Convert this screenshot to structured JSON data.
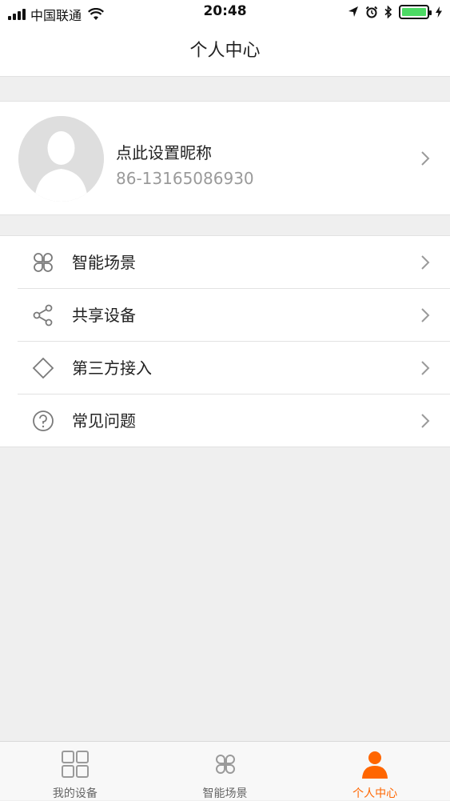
{
  "status_bar": {
    "carrier": "中国联通",
    "time": "20:48",
    "battery_level": 1.0
  },
  "nav": {
    "title": "个人中心"
  },
  "profile": {
    "nickname": "点此设置昵称",
    "phone": "86-13165086930"
  },
  "menu": {
    "items": [
      {
        "label": "智能场景",
        "icon": "scene-icon"
      },
      {
        "label": "共享设备",
        "icon": "share-icon"
      },
      {
        "label": "第三方接入",
        "icon": "diamond-icon"
      },
      {
        "label": "常见问题",
        "icon": "help-icon"
      }
    ]
  },
  "tabs": {
    "items": [
      {
        "label": "我的设备",
        "icon": "grid-icon"
      },
      {
        "label": "智能场景",
        "icon": "scene-icon"
      },
      {
        "label": "个人中心",
        "icon": "person-icon",
        "active": true
      }
    ]
  },
  "colors": {
    "accent": "#ff6600",
    "background": "#efefef",
    "battery": "#4cd964"
  }
}
